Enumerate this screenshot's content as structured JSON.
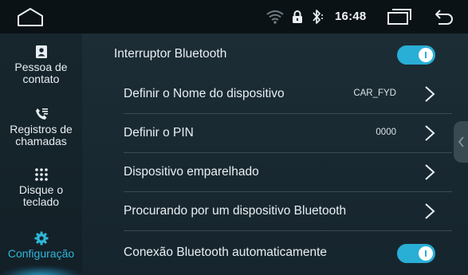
{
  "status_bar": {
    "time": "16:48",
    "icons": [
      "home-icon",
      "wifi-icon",
      "lock-icon",
      "bluetooth-icon",
      "recent-apps-icon",
      "back-icon"
    ]
  },
  "sidebar": {
    "items": [
      {
        "label": "Pessoa de\ncontato",
        "icon": "contact-icon",
        "active": false
      },
      {
        "label": "Registros de\nchamadas",
        "icon": "call-log-icon",
        "active": false
      },
      {
        "label": "Disque o\nteclado",
        "icon": "dialpad-icon",
        "active": false
      },
      {
        "label": "Configuração",
        "icon": "gear-icon",
        "active": true
      }
    ]
  },
  "settings": {
    "bluetooth_switch": {
      "label": "Interruptor Bluetooth",
      "on": true
    },
    "device_name": {
      "label": "Definir o Nome do dispositivo",
      "value": "CAR_FYD"
    },
    "pin": {
      "label": "Definir o PIN",
      "value": "0000"
    },
    "paired": {
      "label": "Dispositivo emparelhado"
    },
    "search": {
      "label": "Procurando por um dispositivo Bluetooth"
    },
    "auto_connect": {
      "label": "Conexão Bluetooth automaticamente",
      "on": true
    }
  },
  "colors": {
    "accent": "#29aed6",
    "active_nav_text": "#2fb7d9",
    "background": "#1c2d35",
    "sidebar": "#17262d"
  }
}
